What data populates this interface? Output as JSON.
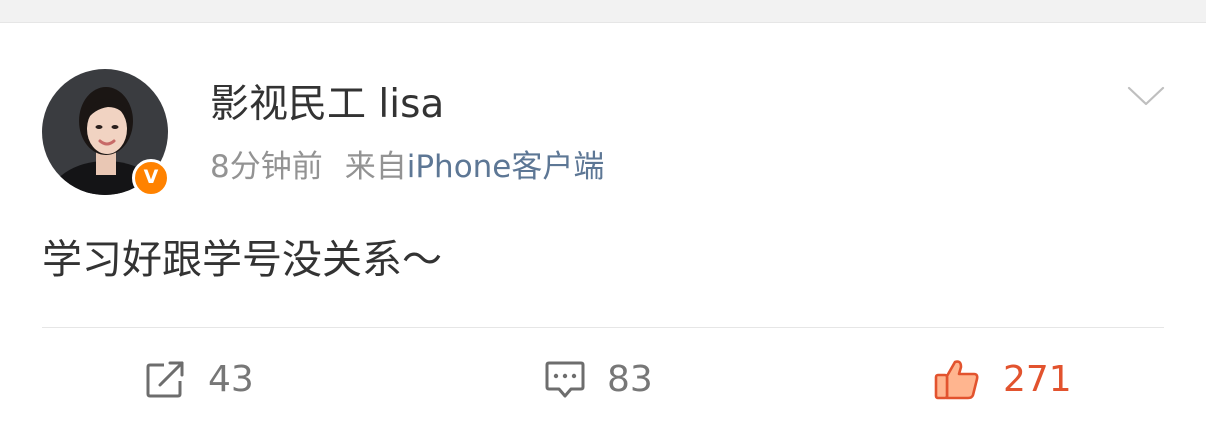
{
  "post": {
    "author": {
      "name": "影视民工 lisa",
      "badge": "V",
      "badge_color": "#ff8200"
    },
    "time": "8分钟前",
    "source_prefix": "来自",
    "source": "iPhone客户端",
    "text": "学习好跟学号没关系～",
    "more_icon": "chevron-down-icon"
  },
  "actions": {
    "repost": {
      "icon": "repost-icon",
      "count": "43"
    },
    "comment": {
      "icon": "comment-icon",
      "count": "83"
    },
    "like": {
      "icon": "thumbs-up-icon",
      "count": "271",
      "color": "#e2532e"
    }
  },
  "colors": {
    "text_primary": "#333333",
    "text_meta": "#939393",
    "source_link": "#5d7795",
    "divider": "#e6e6e6"
  }
}
